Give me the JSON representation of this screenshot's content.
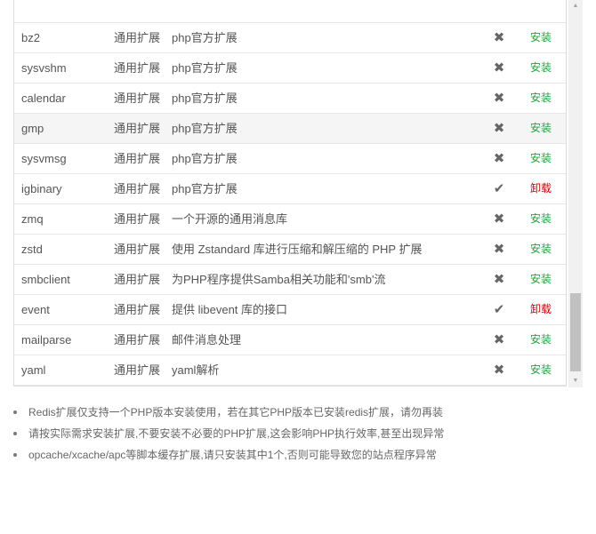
{
  "extensions": [
    {
      "name": "bz2",
      "type": "通用扩展",
      "desc": "php官方扩展",
      "installed": false,
      "action": "安装"
    },
    {
      "name": "sysvshm",
      "type": "通用扩展",
      "desc": "php官方扩展",
      "installed": false,
      "action": "安装"
    },
    {
      "name": "calendar",
      "type": "通用扩展",
      "desc": "php官方扩展",
      "installed": false,
      "action": "安装"
    },
    {
      "name": "gmp",
      "type": "通用扩展",
      "desc": "php官方扩展",
      "installed": false,
      "action": "安装"
    },
    {
      "name": "sysvmsg",
      "type": "通用扩展",
      "desc": "php官方扩展",
      "installed": false,
      "action": "安装"
    },
    {
      "name": "igbinary",
      "type": "通用扩展",
      "desc": "php官方扩展",
      "installed": true,
      "action": "卸载"
    },
    {
      "name": "zmq",
      "type": "通用扩展",
      "desc": "一个开源的通用消息库",
      "installed": false,
      "action": "安装"
    },
    {
      "name": "zstd",
      "type": "通用扩展",
      "desc": "使用 Zstandard 库进行压缩和解压缩的 PHP 扩展",
      "installed": false,
      "action": "安装"
    },
    {
      "name": "smbclient",
      "type": "通用扩展",
      "desc": "为PHP程序提供Samba相关功能和'smb'流",
      "installed": false,
      "action": "安装"
    },
    {
      "name": "event",
      "type": "通用扩展",
      "desc": "提供 libevent 库的接口",
      "installed": true,
      "action": "卸载"
    },
    {
      "name": "mailparse",
      "type": "通用扩展",
      "desc": "邮件消息处理",
      "installed": false,
      "action": "安装"
    },
    {
      "name": "yaml",
      "type": "通用扩展",
      "desc": "yaml解析",
      "installed": false,
      "action": "安装"
    }
  ],
  "icons": {
    "not_installed": "✖",
    "installed": "✔"
  },
  "colors": {
    "install": "#20a53a",
    "uninstall": "#cc0000"
  },
  "notes": [
    "Redis扩展仅支持一个PHP版本安装使用，若在其它PHP版本已安装redis扩展，请勿再装",
    "请按实际需求安装扩展,不要安装不必要的PHP扩展,这会影响PHP执行效率,甚至出现异常",
    "opcache/xcache/apc等脚本缓存扩展,请只安装其中1个,否则可能导致您的站点程序异常"
  ]
}
